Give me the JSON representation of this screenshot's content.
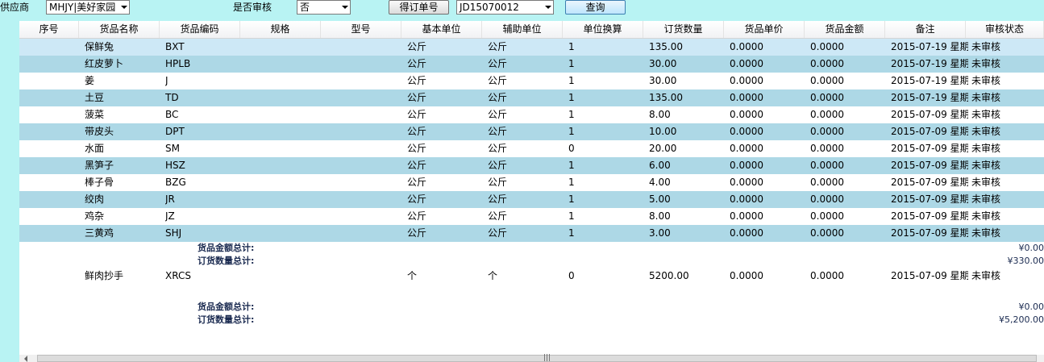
{
  "toolbar": {
    "supplier_label": "供应商",
    "supplier_value": "MHJY|美好家园",
    "audit_label": "是否审核",
    "audit_value": "否",
    "get_order_button": "得订单号",
    "order_number": "JD15070012",
    "query_button": "查询"
  },
  "grid": {
    "columns": [
      "序号",
      "货品名称",
      "货品编码",
      "规格",
      "型号",
      "基本单位",
      "辅助单位",
      "单位换算",
      "订货数量",
      "货品单价",
      "货品金额",
      "备注",
      "审核状态"
    ],
    "group1": [
      {
        "name": "保鲜兔",
        "code": "BXT",
        "unit": "公斤",
        "aux": "公斤",
        "conv": "1",
        "qty": "135.00",
        "price": "0.0000",
        "amount": "0.0000",
        "note": "2015-07-19 星期",
        "status": "未审核"
      },
      {
        "name": "红皮萝卜",
        "code": "HPLB",
        "unit": "公斤",
        "aux": "公斤",
        "conv": "1",
        "qty": "30.00",
        "price": "0.0000",
        "amount": "0.0000",
        "note": "2015-07-19 星期",
        "status": "未审核"
      },
      {
        "name": "姜",
        "code": "J",
        "unit": "公斤",
        "aux": "公斤",
        "conv": "1",
        "qty": "30.00",
        "price": "0.0000",
        "amount": "0.0000",
        "note": "2015-07-19 星期",
        "status": "未审核"
      },
      {
        "name": "土豆",
        "code": "TD",
        "unit": "公斤",
        "aux": "公斤",
        "conv": "1",
        "qty": "135.00",
        "price": "0.0000",
        "amount": "0.0000",
        "note": "2015-07-19 星期",
        "status": "未审核"
      },
      {
        "name": "菠菜",
        "code": "BC",
        "unit": "公斤",
        "aux": "公斤",
        "conv": "1",
        "qty": "8.00",
        "price": "0.0000",
        "amount": "0.0000",
        "note": "2015-07-09 星期",
        "status": "未审核"
      },
      {
        "name": "带皮头",
        "code": "DPT",
        "unit": "公斤",
        "aux": "公斤",
        "conv": "1",
        "qty": "10.00",
        "price": "0.0000",
        "amount": "0.0000",
        "note": "2015-07-09 星期",
        "status": "未审核"
      },
      {
        "name": "水面",
        "code": "SM",
        "unit": "公斤",
        "aux": "公斤",
        "conv": "0",
        "qty": "20.00",
        "price": "0.0000",
        "amount": "0.0000",
        "note": "2015-07-09 星期",
        "status": "未审核"
      },
      {
        "name": "黑笋子",
        "code": "HSZ",
        "unit": "公斤",
        "aux": "公斤",
        "conv": "1",
        "qty": "6.00",
        "price": "0.0000",
        "amount": "0.0000",
        "note": "2015-07-09 星期",
        "status": "未审核"
      },
      {
        "name": "棒子骨",
        "code": "BZG",
        "unit": "公斤",
        "aux": "公斤",
        "conv": "1",
        "qty": "4.00",
        "price": "0.0000",
        "amount": "0.0000",
        "note": "2015-07-09 星期",
        "status": "未审核"
      },
      {
        "name": "绞肉",
        "code": "JR",
        "unit": "公斤",
        "aux": "公斤",
        "conv": "1",
        "qty": "5.00",
        "price": "0.0000",
        "amount": "0.0000",
        "note": "2015-07-09 星期",
        "status": "未审核"
      },
      {
        "name": "鸡杂",
        "code": "JZ",
        "unit": "公斤",
        "aux": "公斤",
        "conv": "1",
        "qty": "8.00",
        "price": "0.0000",
        "amount": "0.0000",
        "note": "2015-07-09 星期",
        "status": "未审核"
      },
      {
        "name": "三黄鸡",
        "code": "SHJ",
        "unit": "公斤",
        "aux": "公斤",
        "conv": "1",
        "qty": "3.00",
        "price": "0.0000",
        "amount": "0.0000",
        "note": "2015-07-09 星期",
        "status": "未审核"
      }
    ],
    "summary1": {
      "amount_label": "货品金额总计:",
      "amount_value": "¥0.00",
      "qty_label": "订货数量总计:",
      "qty_value": "¥330.00"
    },
    "group2": [
      {
        "name": "鲜肉抄手",
        "code": "XRCS",
        "unit": "个",
        "aux": "个",
        "conv": "0",
        "qty": "5200.00",
        "price": "0.0000",
        "amount": "0.0000",
        "note": "2015-07-09 星期",
        "status": "未审核"
      }
    ],
    "summary2": {
      "amount_label": "货品金额总计:",
      "amount_value": "¥0.00",
      "qty_label": "订货数量总计:",
      "qty_value": "¥5,200.00"
    }
  }
}
